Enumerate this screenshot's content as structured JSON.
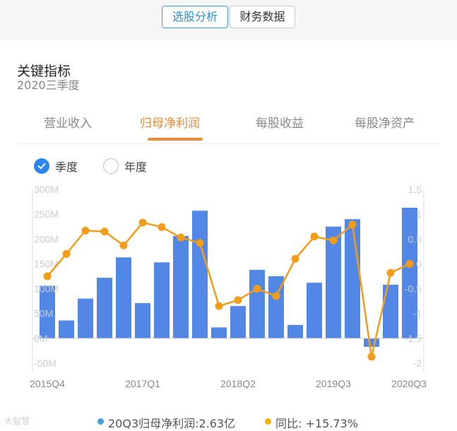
{
  "top_tabs": {
    "active": "选股分析",
    "inactive": "财务数据"
  },
  "card": {
    "title": "关键指标",
    "subtitle": "2020三季度"
  },
  "metric_tabs": [
    "营业收入",
    "归母净利润",
    "每股收益",
    "每股净资产"
  ],
  "period_toggle": {
    "quarter": "季度",
    "year": "年度",
    "selected": "季度"
  },
  "footer": {
    "watermark": "大智慧",
    "value_label": "20Q3归母净利润:2.63亿",
    "yoy_label": "同比: +15.73%"
  },
  "colors": {
    "bar": "#5287e6",
    "line": "#f29d19",
    "accent": "#ef8a36",
    "active_blue": "#2f8fd8"
  },
  "chart_data": {
    "type": "bar",
    "x": [
      "2015Q4",
      "2016Q1",
      "2016Q2",
      "2016Q3",
      "2016Q4",
      "2017Q1",
      "2017Q2",
      "2017Q3",
      "2017Q4",
      "2018Q1",
      "2018Q2",
      "2018Q3",
      "2018Q4",
      "2019Q1",
      "2019Q2",
      "2019Q3",
      "2019Q4",
      "2020Q1",
      "2020Q2",
      "2020Q3"
    ],
    "xtick_labels": [
      "2015Q4",
      "2017Q1",
      "2018Q2",
      "2019Q3",
      "2020Q3"
    ],
    "series": [
      {
        "type": "bar",
        "axis": "left",
        "values": [
          106,
          36,
          80,
          122,
          163,
          71,
          153,
          206,
          257,
          22,
          65,
          138,
          125,
          27,
          112,
          225,
          240,
          -17,
          108,
          263
        ]
      },
      {
        "type": "line",
        "axis": "right",
        "values": [
          -0.25,
          0.2,
          0.67,
          0.65,
          0.37,
          0.83,
          0.74,
          0.53,
          0.42,
          -0.85,
          -0.73,
          -0.5,
          -0.65,
          0.1,
          0.55,
          0.47,
          0.79,
          -1.87,
          -0.18,
          0.0
        ]
      }
    ],
    "left_axis": {
      "ticks": [
        "300M",
        "250M",
        "200M",
        "150M",
        "100M",
        "50M",
        "0M",
        "-50M"
      ],
      "ylim": [
        -50,
        300
      ]
    },
    "right_axis": {
      "ticks": [
        "1.5",
        "1",
        "0.5",
        "0",
        "-0.5",
        "-1",
        "-1.5",
        "-2"
      ],
      "ylim": [
        -2,
        1.5
      ]
    },
    "grid": false
  }
}
